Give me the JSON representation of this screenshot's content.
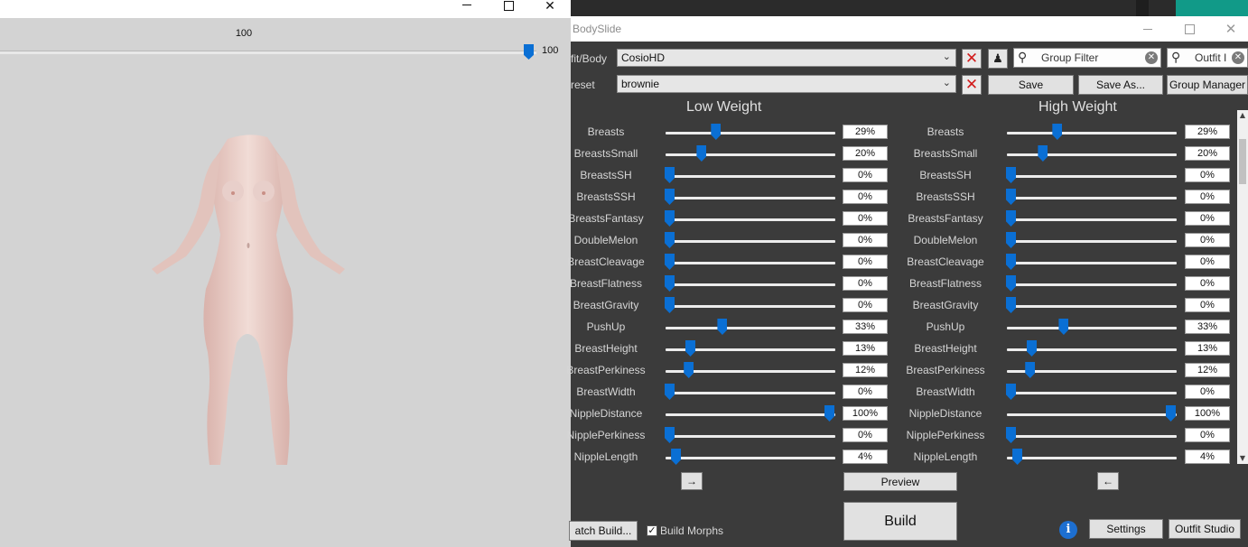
{
  "preview": {
    "slider_value_label": "100",
    "slider_max_label": "100",
    "slider_fraction": 1.0,
    "close_glyph": "✕"
  },
  "bodyslide": {
    "title": "BodySlide",
    "close_glyph": "✕",
    "outfit_label": "fit/Body",
    "outfit_value": "CosioHD",
    "preset_label": "reset",
    "preset_value": "brownie",
    "group_filter_placeholder": "Group Filter",
    "outfit_filter_placeholder": "Outfit I",
    "save_label": "Save",
    "save_as_label": "Save As...",
    "group_manager_label": "Group Manager",
    "low_weight_heading": "Low Weight",
    "high_weight_heading": "High Weight",
    "copy_right_glyph": "→",
    "copy_left_glyph": "←",
    "preview_label": "Preview",
    "build_label": "Build",
    "batch_build_label": "atch Build...",
    "build_morphs_label": "Build Morphs",
    "build_morphs_checked": true,
    "settings_label": "Settings",
    "outfit_studio_label": "Outfit Studio",
    "info_glyph": "i",
    "sliders": [
      {
        "name": "Breasts",
        "low": "29%",
        "low_frac": 0.29,
        "high": "29%",
        "high_frac": 0.29
      },
      {
        "name": "BreastsSmall",
        "low": "20%",
        "low_frac": 0.2,
        "high": "20%",
        "high_frac": 0.2
      },
      {
        "name": "BreastsSH",
        "low": "0%",
        "low_frac": 0,
        "high": "0%",
        "high_frac": 0
      },
      {
        "name": "BreastsSSH",
        "low": "0%",
        "low_frac": 0,
        "high": "0%",
        "high_frac": 0
      },
      {
        "name": "BreastsFantasy",
        "low": "0%",
        "low_frac": 0,
        "high": "0%",
        "high_frac": 0
      },
      {
        "name": "DoubleMelon",
        "low": "0%",
        "low_frac": 0,
        "high": "0%",
        "high_frac": 0
      },
      {
        "name": "BreastCleavage",
        "low": "0%",
        "low_frac": 0,
        "high": "0%",
        "high_frac": 0
      },
      {
        "name": "BreastFlatness",
        "low": "0%",
        "low_frac": 0,
        "high": "0%",
        "high_frac": 0
      },
      {
        "name": "BreastGravity",
        "low": "0%",
        "low_frac": 0,
        "high": "0%",
        "high_frac": 0
      },
      {
        "name": "PushUp",
        "low": "33%",
        "low_frac": 0.33,
        "high": "33%",
        "high_frac": 0.33
      },
      {
        "name": "BreastHeight",
        "low": "13%",
        "low_frac": 0.13,
        "high": "13%",
        "high_frac": 0.13
      },
      {
        "name": "BreastPerkiness",
        "low": "12%",
        "low_frac": 0.12,
        "high": "12%",
        "high_frac": 0.12
      },
      {
        "name": "BreastWidth",
        "low": "0%",
        "low_frac": 0,
        "high": "0%",
        "high_frac": 0
      },
      {
        "name": "NippleDistance",
        "low": "100%",
        "low_frac": 1.0,
        "high": "100%",
        "high_frac": 1.0
      },
      {
        "name": "NipplePerkiness",
        "low": "0%",
        "low_frac": 0,
        "high": "0%",
        "high_frac": 0
      },
      {
        "name": "NippleLength",
        "low": "4%",
        "low_frac": 0.04,
        "high": "4%",
        "high_frac": 0.04
      }
    ]
  }
}
